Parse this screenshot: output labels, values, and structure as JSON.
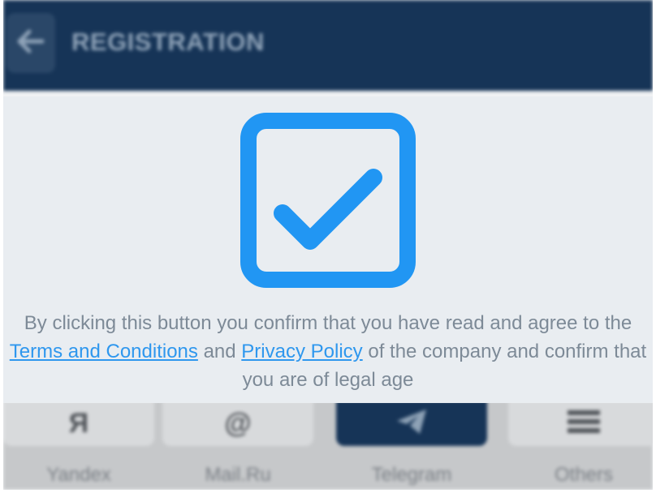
{
  "header": {
    "title": "REGISTRATION",
    "back_icon": "arrow-left-icon"
  },
  "modal": {
    "icon": "checkbox-checked-icon",
    "accent_color": "#2196f3",
    "text_before": "By clicking this button you confirm that you have read and agree to the",
    "terms_link": "Terms and Conditions",
    "and_text": " and ",
    "privacy_link": "Privacy Policy",
    "text_after": " of the company and confirm that you are of legal age"
  },
  "methods": [
    {
      "label": "Yandex",
      "glyph": "Я",
      "icon": "yandex-icon",
      "active": false
    },
    {
      "label": "Mail.Ru",
      "glyph": "@",
      "icon": "at-sign-icon",
      "active": false
    },
    {
      "label": "Telegram",
      "glyph": "",
      "icon": "telegram-plane-icon",
      "active": true
    },
    {
      "label": "Others",
      "glyph": "",
      "icon": "menu-icon",
      "active": false
    }
  ]
}
